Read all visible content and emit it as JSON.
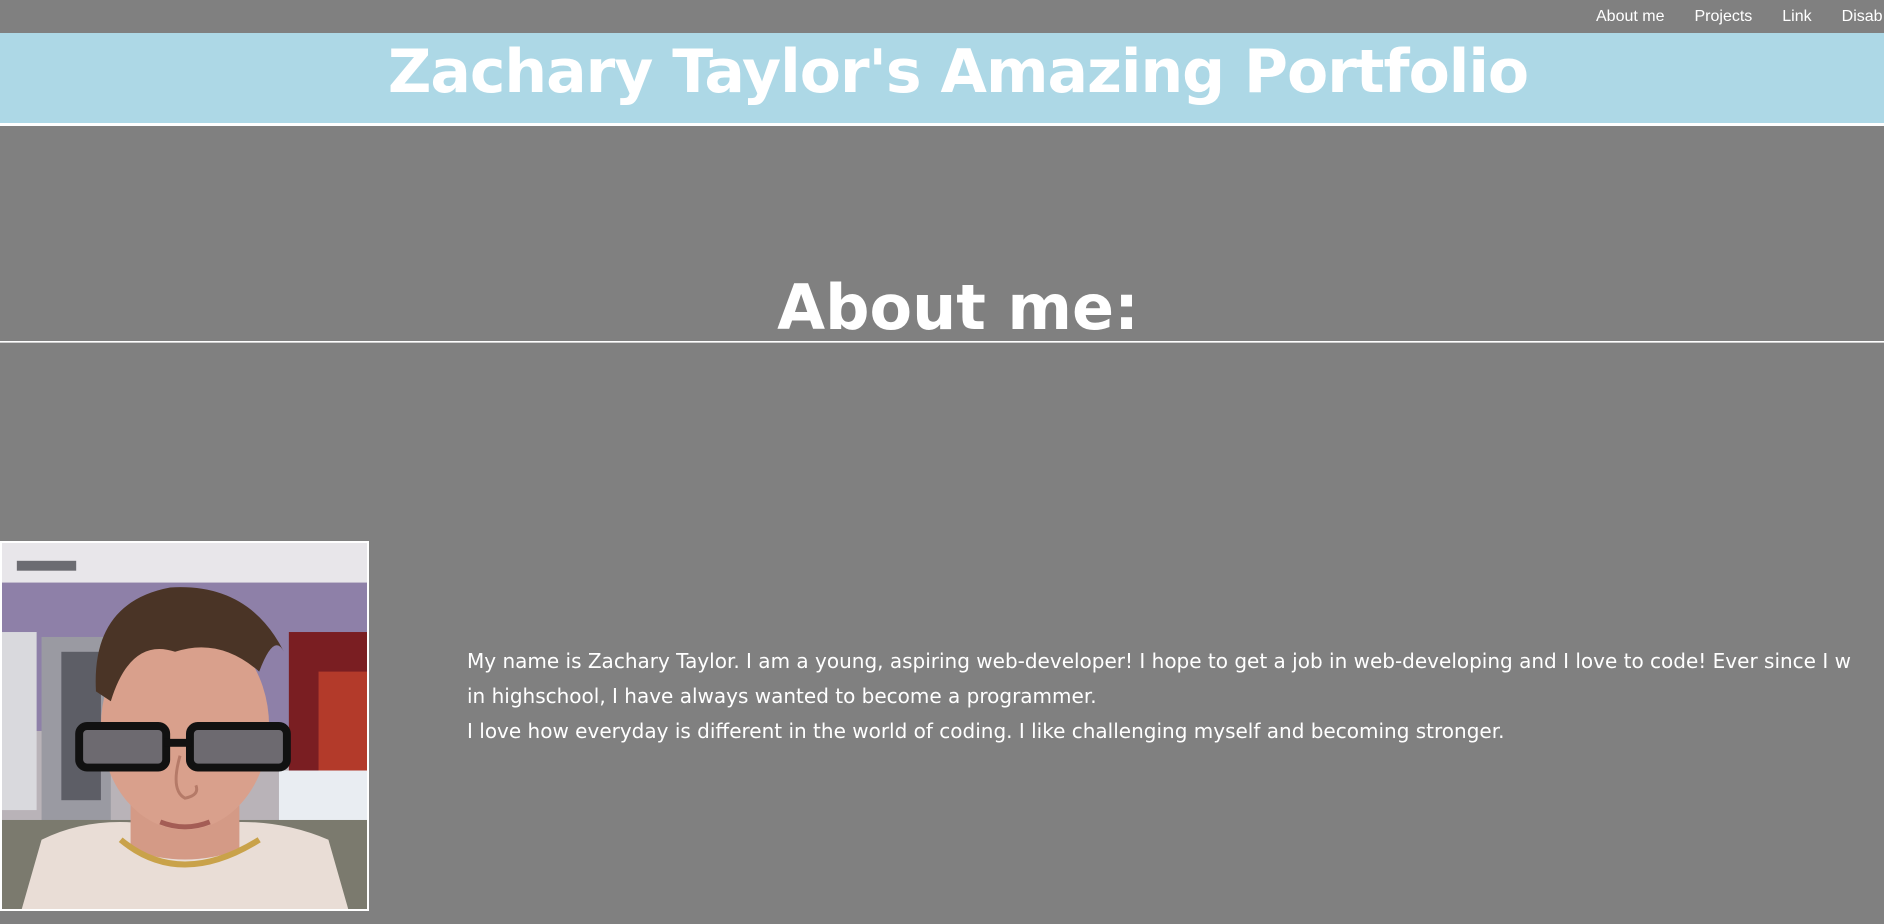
{
  "nav": {
    "items": [
      {
        "label": "About me"
      },
      {
        "label": "Projects"
      },
      {
        "label": "Link"
      },
      {
        "label": "Disab"
      }
    ]
  },
  "header": {
    "title": "Zachary Taylor's Amazing Portfolio"
  },
  "about": {
    "heading": "About me:",
    "bio_line1": "My name is Zachary Taylor. I am a young, aspiring web-developer! I hope to get a job in web-developing and I love to code! Ever since I w",
    "bio_line2": "in highschool, I have always wanted to become a programmer.",
    "bio_line3": "I love how everyday is different in the world of coding. I like challenging myself and becoming stronger."
  },
  "colors": {
    "page_background": "#808080",
    "banner_background": "#add8e6",
    "text": "#ffffff"
  }
}
